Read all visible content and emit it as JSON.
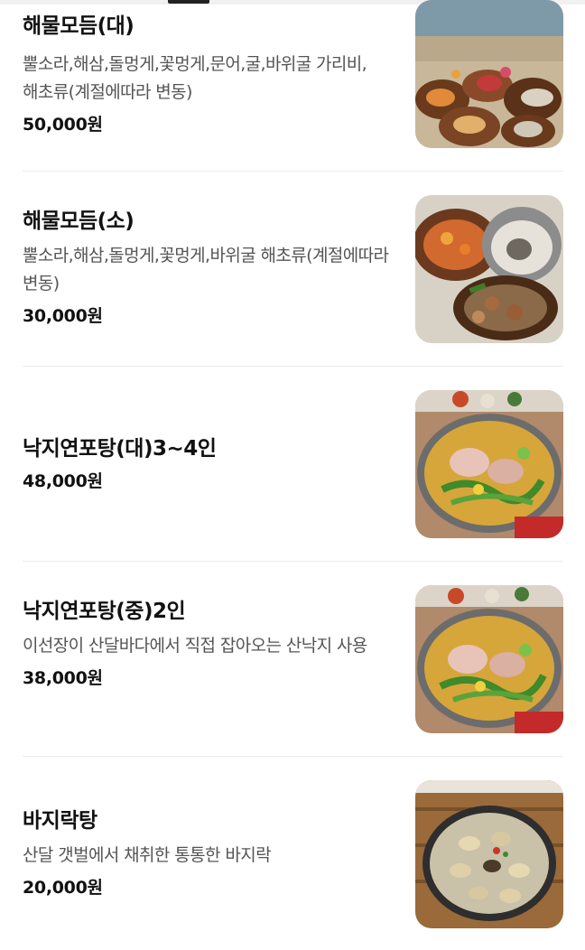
{
  "menu": {
    "items": [
      {
        "name": "해물모듬(대)",
        "description": "뿔소라,해삼,돌멍게,꽃멍게,문어,굴,바위굴 가리비,해초류(계절에따라 변동)",
        "price": "50,000원",
        "photo_icon": "seafood-platter-photo"
      },
      {
        "name": "해물모듬(소)",
        "description": "뿔소라,해삼,돌멍게,꽃멍게,바위굴 해초류(계절에따라 변동)",
        "price": "30,000원",
        "photo_icon": "seafood-platter-photo"
      },
      {
        "name": "낙지연포탕(대)3~4인",
        "description": "",
        "price": "48,000원",
        "photo_icon": "octopus-hotpot-photo"
      },
      {
        "name": "낙지연포탕(중)2인",
        "description": "이선장이 산달바다에서 직접 잡아오는 산낙지 사용",
        "price": "38,000원",
        "photo_icon": "octopus-hotpot-photo"
      },
      {
        "name": "바지락탕",
        "description": "산달 갯벌에서 채취한 통통한 바지락",
        "price": "20,000원",
        "photo_icon": "clam-soup-photo"
      }
    ]
  }
}
